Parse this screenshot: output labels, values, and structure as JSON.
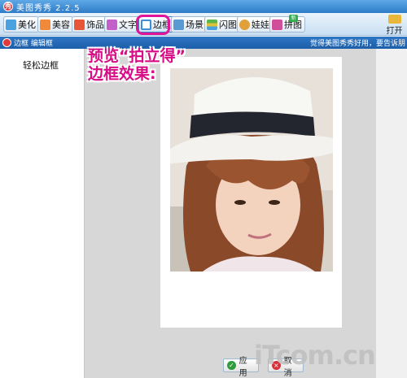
{
  "window": {
    "title": "美图秀秀 2.2.5",
    "icon": "xiu-logo-icon"
  },
  "toolbar": {
    "buttons": [
      {
        "label": "美化",
        "icon": "landscape-icon",
        "color": "#4aa1e0"
      },
      {
        "label": "美容",
        "icon": "face-icon",
        "color": "#f08a3a"
      },
      {
        "label": "饰品",
        "icon": "heart-icon",
        "color": "#e8563a"
      },
      {
        "label": "文字",
        "icon": "text-icon",
        "color": "#c45ec8"
      },
      {
        "label": "边框",
        "icon": "frame-icon",
        "color": "#3f8fd8",
        "active": true
      },
      {
        "label": "场景",
        "icon": "scene-icon",
        "color": "#5a9ad2"
      },
      {
        "label": "闪图",
        "icon": "flash-icon",
        "color": "#5bb54a"
      },
      {
        "label": "娃娃",
        "icon": "doll-icon",
        "color": "#e0a03a"
      },
      {
        "label": "拼图",
        "icon": "puzzle-icon",
        "color": "#d14f9a",
        "badge": "新"
      }
    ],
    "open_label": "打开",
    "open_icon": "folder-icon"
  },
  "subbar": {
    "title": "边框 编辑框",
    "right_text": "觉得美图秀秀好用，要告诉朋"
  },
  "sidebar": {
    "items": [
      {
        "label": "轻松边框"
      }
    ]
  },
  "annotation": {
    "line1": "预览“拍立得”",
    "line2": "边框效果:",
    "color": "#d60d85"
  },
  "actions": {
    "apply_label": "应用",
    "cancel_label": "取消"
  },
  "watermark": "iTcom.cn",
  "colors": {
    "accent": "#2e7cc8",
    "canvas_bg": "#d7d7d7",
    "highlight": "#e0159a"
  }
}
